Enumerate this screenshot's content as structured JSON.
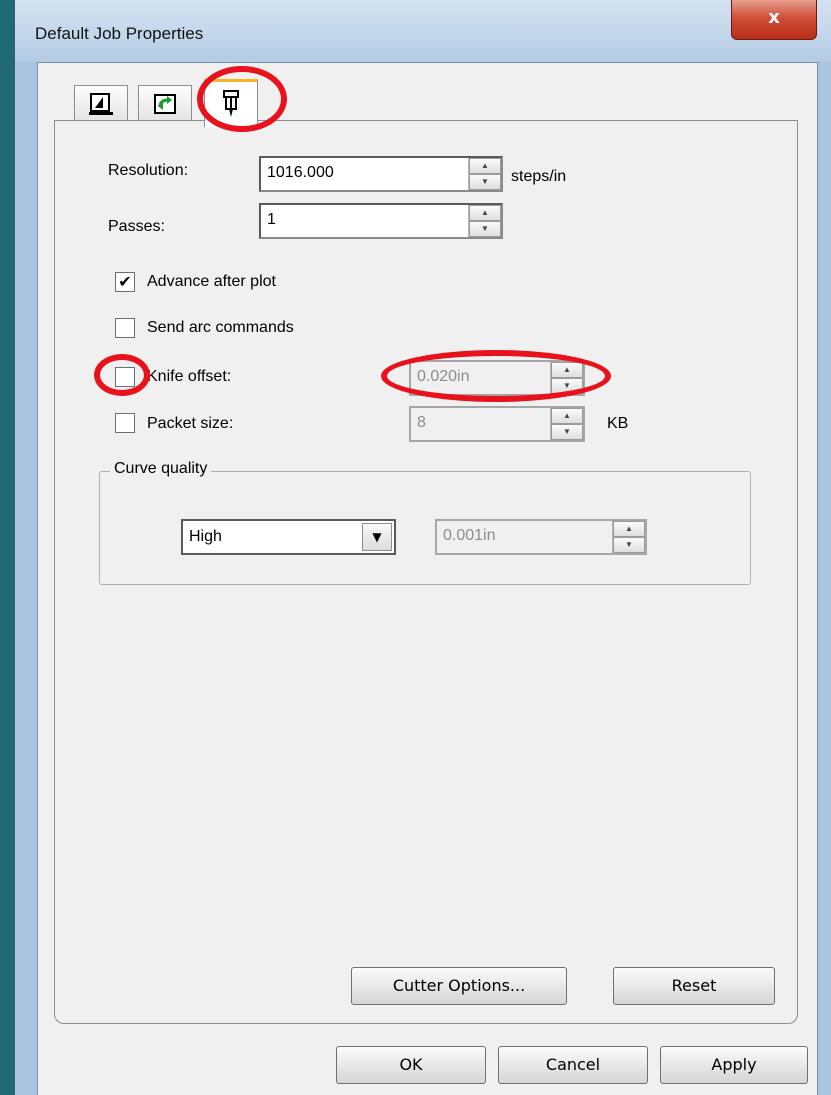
{
  "window": {
    "title": "Default Job Properties",
    "close_glyph": "x"
  },
  "tabs": [
    {
      "icon": "page-setup-icon"
    },
    {
      "icon": "transform-icon"
    },
    {
      "icon": "cutter-knife-icon",
      "active": true
    }
  ],
  "fields": {
    "resolution": {
      "label": "Resolution:",
      "value": "1016.000",
      "unit": "steps/in"
    },
    "passes": {
      "label": "Passes:",
      "value": "1"
    },
    "advance_after_plot": {
      "label": "Advance after plot",
      "checked": true
    },
    "send_arc_commands": {
      "label": "Send arc commands",
      "checked": false
    },
    "knife_offset": {
      "label": "Knife offset:",
      "checked": false,
      "value": "0.020in"
    },
    "packet_size": {
      "label": "Packet size:",
      "checked": false,
      "value": "8",
      "unit": "KB"
    }
  },
  "curve_quality": {
    "legend": "Curve quality",
    "selected": "High",
    "value": "0.001in"
  },
  "buttons": {
    "cutter_options": "Cutter Options...",
    "reset": "Reset",
    "ok": "OK",
    "cancel": "Cancel",
    "apply": "Apply"
  },
  "colors": {
    "highlight_ring": "#e8121c",
    "active_tab_accent": "#f5b52a"
  }
}
